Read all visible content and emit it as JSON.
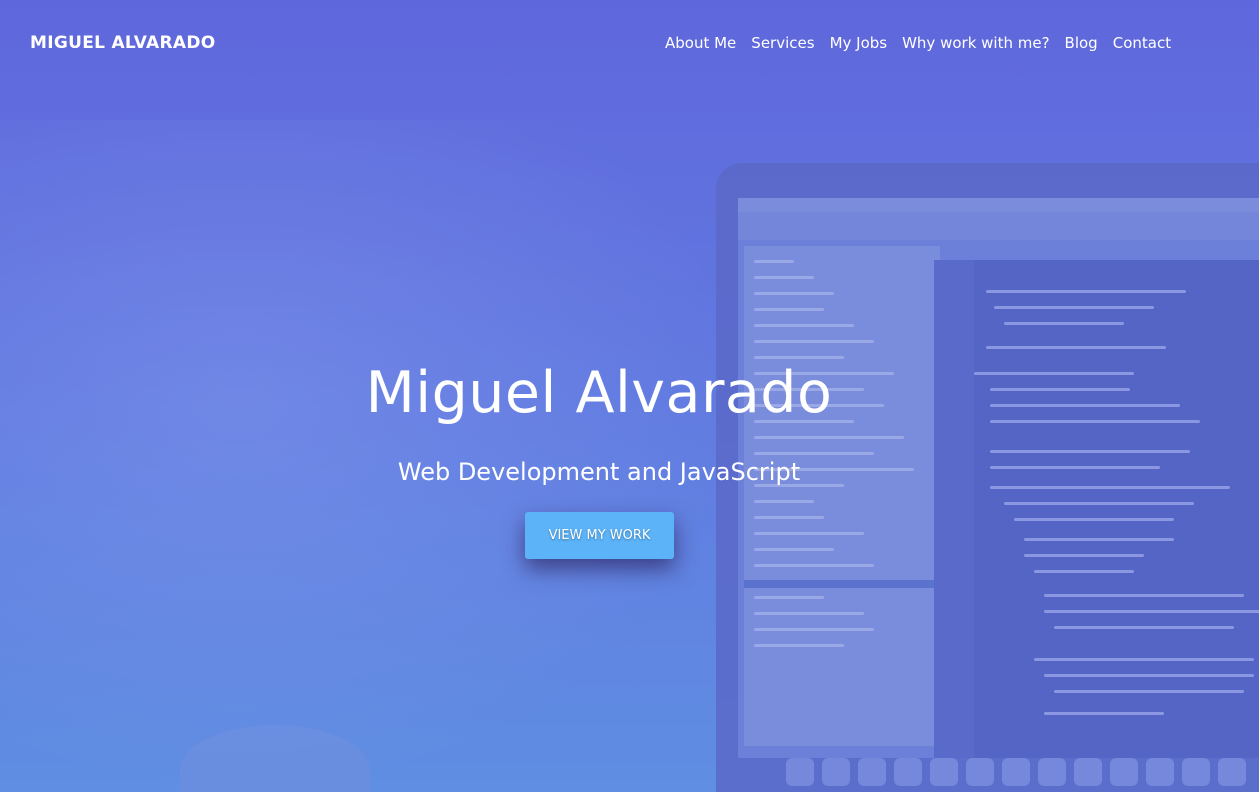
{
  "header": {
    "logo": "MIGUEL ALVARADO",
    "nav": [
      {
        "label": "About Me"
      },
      {
        "label": "Services"
      },
      {
        "label": "My Jobs"
      },
      {
        "label": "Why work with me?"
      },
      {
        "label": "Blog"
      },
      {
        "label": "Contact"
      }
    ]
  },
  "hero": {
    "title": "Miguel Alvarado",
    "subtitle": "Web Development and JavaScript",
    "cta_label": "VIEW MY WORK"
  },
  "colors": {
    "background_top": "#5f67dc",
    "background_bottom": "#5f8ee2",
    "cta": "#5cb3f8",
    "text": "#ffffff"
  }
}
